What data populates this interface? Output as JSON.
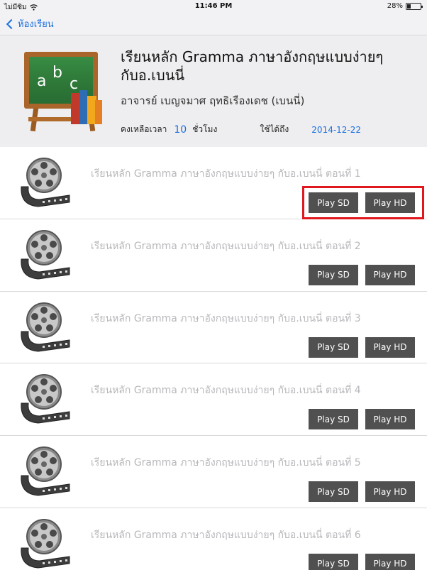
{
  "status_bar": {
    "carrier": "ไม่มีซิม",
    "time": "11:46 PM",
    "battery": "28%",
    "battery_level": 0.28
  },
  "nav": {
    "back_label": "ห้องเรียน"
  },
  "course": {
    "title_line1": "เรียนหลัก Gramma ภาษาอังกฤษแบบง่ายๆ",
    "title_line2": "กับอ.เบนนี่",
    "teacher": "อาจารย์  เบญจมาศ  ฤทธิเรืองเดช   (เบนนี่)",
    "remaining_label": "คงเหลือเวลา",
    "remaining_hours": "10",
    "hours_unit": "ชั่วโมง",
    "valid_until_label": "ใช้ได้ถึง",
    "valid_until_date": "2014-12-22"
  },
  "episodes": [
    {
      "title": "เรียนหลัก Gramma ภาษาอังกฤษแบบง่ายๆ กับอ.เบนนี่ ตอนที่ 1",
      "sd_label": "Play SD",
      "hd_label": "Play HD"
    },
    {
      "title": "เรียนหลัก Gramma ภาษาอังกฤษแบบง่ายๆ กับอ.เบนนี่ ตอนที่ 2",
      "sd_label": "Play SD",
      "hd_label": "Play HD"
    },
    {
      "title": "เรียนหลัก Gramma ภาษาอังกฤษแบบง่ายๆ กับอ.เบนนี่ ตอนที่ 3",
      "sd_label": "Play SD",
      "hd_label": "Play HD"
    },
    {
      "title": "เรียนหลัก Gramma ภาษาอังกฤษแบบง่ายๆ กับอ.เบนนี่ ตอนที่ 4",
      "sd_label": "Play SD",
      "hd_label": "Play HD"
    },
    {
      "title": "เรียนหลัก Gramma ภาษาอังกฤษแบบง่ายๆ กับอ.เบนนี่ ตอนที่ 5",
      "sd_label": "Play SD",
      "hd_label": "Play HD"
    },
    {
      "title": "เรียนหลัก Gramma ภาษาอังกฤษแบบง่ายๆ กับอ.เบนนี่ ตอนที่ 6",
      "sd_label": "Play SD",
      "hd_label": "Play HD"
    }
  ],
  "colors": {
    "accent": "#1a6fe0",
    "button_bg": "#505050",
    "highlight": "#e0181e"
  },
  "icons": {
    "course": "chalkboard-icon",
    "episode": "film-reel-icon",
    "back": "chevron-left-icon",
    "wifi": "wifi-icon",
    "battery": "battery-icon"
  }
}
